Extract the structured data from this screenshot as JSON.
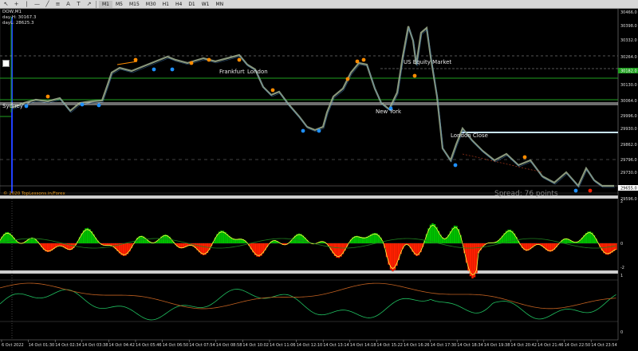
{
  "toolbar": {
    "icons": [
      "cursor-icon",
      "crosshair-icon",
      "vertical-line-icon",
      "horizontal-line-icon",
      "trendline-icon",
      "channel-icon",
      "text-icon",
      "label-icon",
      "arrow-shape-icon"
    ],
    "timeframes": [
      "M1",
      "M5",
      "M15",
      "M30",
      "H1",
      "H4",
      "D1",
      "W1",
      "MN"
    ],
    "active_timeframe": "M1"
  },
  "chart": {
    "symbol": "DOW,M1",
    "info_line1": "day H: 30167.3",
    "info_line2": "dayL: 28625.3",
    "copyright": "© 2020 TopLessons.in/Forex",
    "spread": "Spread: 76 points",
    "sessions": [
      "Sydney",
      "Frankfurt",
      "London",
      "US Equity Market",
      "New York",
      "London Close"
    ],
    "price_labels": [
      "30466.0",
      "30398.0",
      "30332.0",
      "30264.0",
      "30198.0",
      "30130.0",
      "30064.0",
      "29996.0",
      "29930.0",
      "29862.0",
      "29796.0",
      "29730.0",
      "29662.0",
      "29596.0"
    ],
    "current_price_tag": "30182.0",
    "last_price_tag": "29655.0",
    "indicator1_levels": [
      "2",
      "0",
      "-2"
    ],
    "indicator2_levels": [
      "1",
      "0"
    ],
    "time_labels": [
      "6 Oct 2022",
      "14 Oct 01:30",
      "14 Oct 02:34",
      "14 Oct 03:38",
      "14 Oct 04:42",
      "14 Oct 05:46",
      "14 Oct 06:50",
      "14 Oct 07:54",
      "14 Oct 08:58",
      "14 Oct 10:02",
      "14 Oct 11:06",
      "14 Oct 12:10",
      "14 Oct 13:14",
      "14 Oct 14:18",
      "14 Oct 15:22",
      "14 Oct 16:26",
      "14 Oct 17:30",
      "14 Oct 18:34",
      "14 Oct 19:38",
      "14 Oct 20:42",
      "14 Oct 21:46",
      "14 Oct 22:50",
      "14 Oct 23:54"
    ],
    "colors": {
      "bull": "#00c000",
      "bear": "#ff2000",
      "price_line": "#a0b090",
      "session_line": "#00a000"
    }
  }
}
